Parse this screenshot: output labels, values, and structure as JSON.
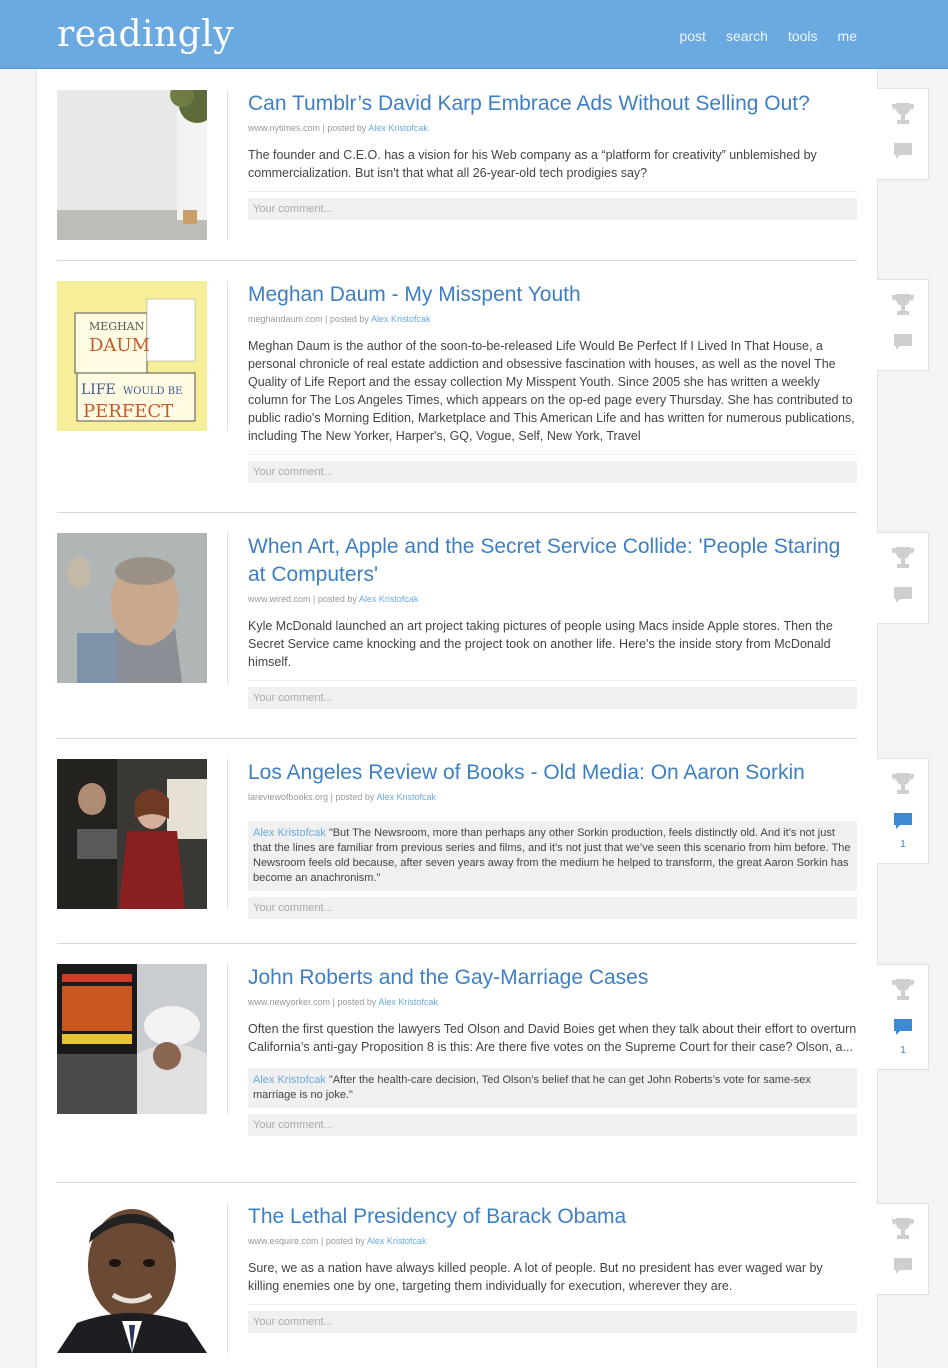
{
  "header": {
    "logo": "readingly",
    "nav": [
      "post",
      "search",
      "tools",
      "me"
    ]
  },
  "comment_placeholder": "Your comment...",
  "posts": [
    {
      "title": "Can Tumblr’s David Karp Embrace Ads Without Selling Out?",
      "source": "www.nytimes.com",
      "posted_by_label": "posted by",
      "author": "Alex Kristofcak",
      "summary": "The founder and C.E.O. has a vision for his Web company as a “platform for creativity” unblemished by commercialization. But isn't that what all 26-year-old tech prodigies say?",
      "comment_count": ""
    },
    {
      "title": "Meghan Daum - My Misspent Youth",
      "source": "meghandaum.com",
      "posted_by_label": "posted by",
      "author": "Alex Kristofcak",
      "summary": "Meghan Daum is the author of the soon-to-be-released Life Would Be Perfect If I Lived In That House, a personal chronicle of real estate addiction and obsessive fascination with houses, as well as the novel The Quality of Life Report and the essay collection My Misspent Youth. Since 2005 she has written a weekly column for The Los Angeles Times, which appears on the op-ed page every Thursday. She has contributed to public radio's Morning Edition, Marketplace and This American Life and has written for numerous publications, including The New Yorker, Harper's, GQ, Vogue, Self, New York, Travel",
      "book": {
        "line1": "MEGHAN",
        "line2": "DAUM",
        "line3": "LIFE",
        "line3b": "WOULD BE",
        "line4": "PERFECT"
      },
      "comment_count": ""
    },
    {
      "title": "When Art, Apple and the Secret Service Collide: 'People Staring at Computers'",
      "source": "www.wired.com",
      "posted_by_label": "posted by",
      "author": "Alex Kristofcak",
      "summary": "Kyle McDonald launched an art project taking pictures of people using Macs inside Apple stores. Then the Secret Service came knocking and the project took on another life. Here's the inside story from McDonald himself.",
      "comment_count": ""
    },
    {
      "title": "Los Angeles Review of Books - Old Media: On Aaron Sorkin",
      "source": "lareviewofbooks.org",
      "posted_by_label": "posted by",
      "author": "Alex Kristofcak",
      "quote_author": "Alex Kristofcak",
      "quote": "\"But The Newsroom, more than perhaps any other Sorkin production, feels distinctly old. And it’s not just that the lines are familiar from previous series and films, and it’s not just that we’ve seen this scenario from him before. The Newsroom feels old because, after seven years away from the medium he helped to transform, the great Aaron Sorkin has become an anachronism.\"",
      "comment_count": "1"
    },
    {
      "title": "John Roberts and the Gay-Marriage Cases",
      "source": "www.newyorker.com",
      "posted_by_label": "posted by",
      "author": "Alex Kristofcak",
      "summary": "Often the first question the lawyers Ted Olson and David Boies get when they talk about their effort to overturn California’s anti-gay Proposition 8 is this: Are there five votes on the Supreme Court for their case? Olson, a...",
      "quote_author": "Alex Kristofcak",
      "quote": "\"After the health-care decision, Ted Olson’s belief that he can get John Roberts’s vote for same-sex marriage is no joke.\"",
      "comment_count": "1"
    },
    {
      "title": "The Lethal Presidency of Barack Obama",
      "source": "www.esquire.com",
      "posted_by_label": "posted by",
      "author": "Alex Kristofcak",
      "summary": "Sure, we as a nation have always killed people. A lot of people. But no president has ever waged war by killing enemies one by one, targeting them individually for execution, wherever they are.",
      "comment_count": ""
    }
  ],
  "colors": {
    "header": "#6aaae0",
    "link": "#3d7fc2",
    "author": "#6aaae0"
  }
}
